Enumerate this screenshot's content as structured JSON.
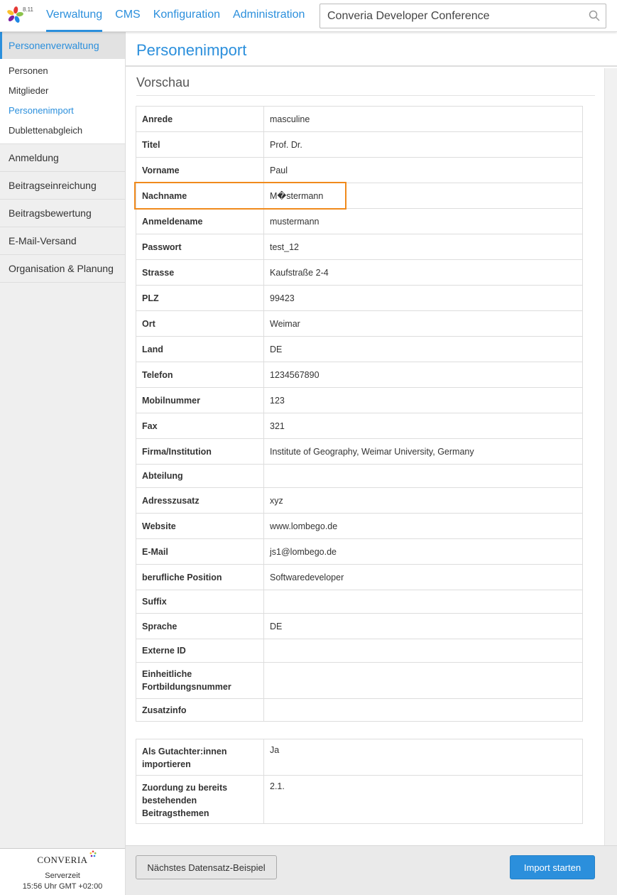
{
  "app": {
    "version": "8.11",
    "logo_icon": "converia-flower-logo-icon",
    "accent_color": "#2b8fdc",
    "highlight_color": "#f08a1c"
  },
  "topnav": {
    "items": [
      {
        "label": "Verwaltung",
        "active": true
      },
      {
        "label": "CMS"
      },
      {
        "label": "Konfiguration"
      },
      {
        "label": "Administration"
      }
    ]
  },
  "search": {
    "value": "Converia Developer Conference",
    "icon": "search-icon"
  },
  "sidebar": {
    "section": "Personenverwaltung",
    "subitems": [
      {
        "label": "Personen"
      },
      {
        "label": "Mitglieder"
      },
      {
        "label": "Personenimport",
        "active": true
      },
      {
        "label": "Dublettenabgleich"
      }
    ],
    "items": [
      {
        "label": "Anmeldung"
      },
      {
        "label": "Beitragseinreichung"
      },
      {
        "label": "Beitragsbewertung"
      },
      {
        "label": "E-Mail-Versand"
      },
      {
        "label": "Organisation & Planung"
      }
    ],
    "footer": {
      "brand": "CONVERIA",
      "server_label": "Serverzeit",
      "server_time": "15:56 Uhr GMT +02:00"
    }
  },
  "main": {
    "title": "Personenimport",
    "section_title": "Vorschau",
    "rows": [
      {
        "key": "Anrede",
        "value": "masculine"
      },
      {
        "key": "Titel",
        "value": "Prof. Dr."
      },
      {
        "key": "Vorname",
        "value": "Paul"
      },
      {
        "key": "Nachname",
        "value": "M�stermann",
        "highlighted": true
      },
      {
        "key": "Anmeldename",
        "value": "mustermann"
      },
      {
        "key": "Passwort",
        "value": "test_12"
      },
      {
        "key": "Strasse",
        "value": "Kaufstraße 2-4"
      },
      {
        "key": "PLZ",
        "value": "99423"
      },
      {
        "key": "Ort",
        "value": "Weimar"
      },
      {
        "key": "Land",
        "value": "DE"
      },
      {
        "key": "Telefon",
        "value": "1234567890"
      },
      {
        "key": "Mobilnummer",
        "value": "123"
      },
      {
        "key": "Fax",
        "value": "321"
      },
      {
        "key": "Firma/Institution",
        "value": "Institute of Geography, Weimar University, Germany"
      },
      {
        "key": "Abteilung",
        "value": ""
      },
      {
        "key": "Adresszusatz",
        "value": "xyz"
      },
      {
        "key": "Website",
        "value": "www.lombego.de"
      },
      {
        "key": "E-Mail",
        "value": "js1@lombego.de"
      },
      {
        "key": "berufliche Position",
        "value": "Softwaredeveloper"
      },
      {
        "key": "Suffix",
        "value": ""
      },
      {
        "key": "Sprache",
        "value": "DE"
      },
      {
        "key": "Externe ID",
        "value": ""
      },
      {
        "key": "Einheitliche Fortbildungsnummer",
        "value": ""
      },
      {
        "key": "Zusatzinfo",
        "value": ""
      }
    ],
    "options": [
      {
        "key": "Als Gutachter:innen importieren",
        "value": "Ja"
      },
      {
        "key": "Zuordung zu bereits bestehenden Beitragsthemen",
        "value": "2.1."
      }
    ]
  },
  "footer": {
    "next_label": "Nächstes Datensatz-Beispiel",
    "import_label": "Import starten"
  }
}
